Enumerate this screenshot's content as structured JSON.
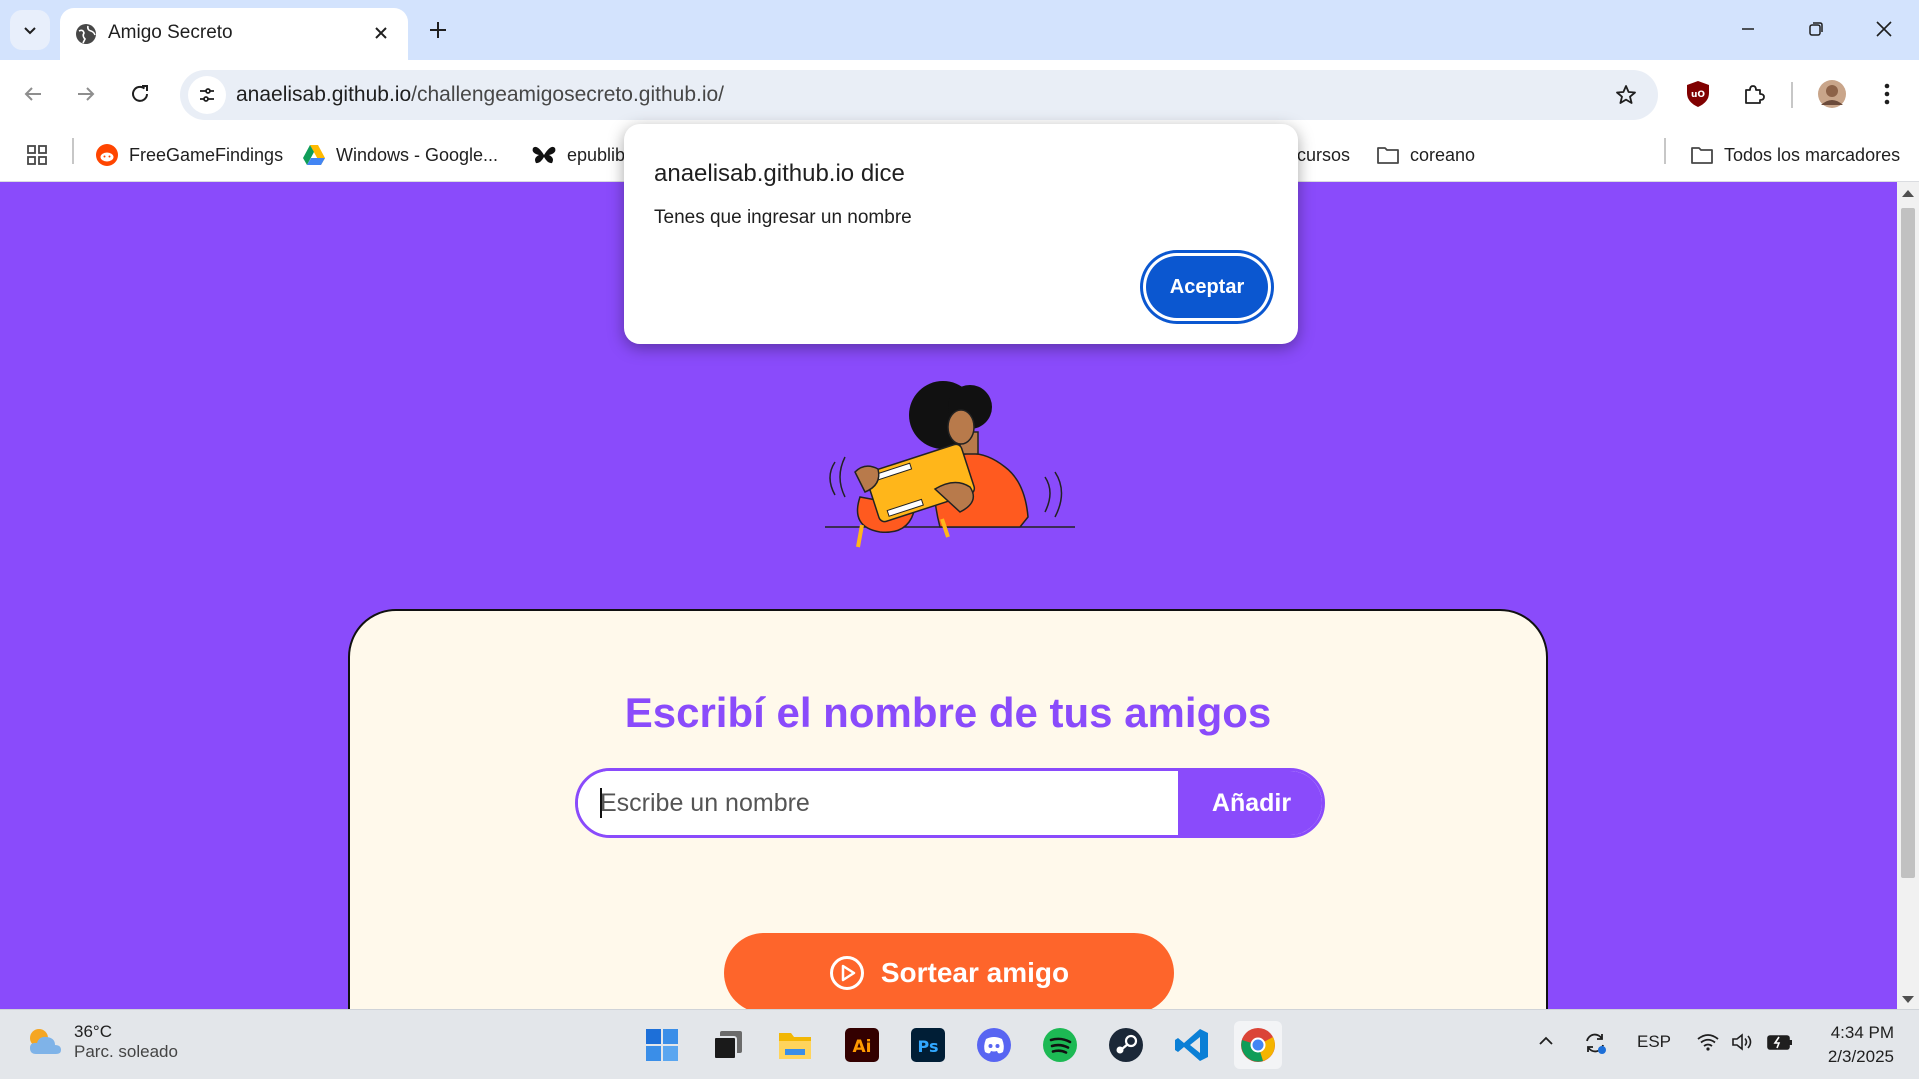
{
  "browser": {
    "tab": {
      "title": "Amigo Secreto"
    },
    "url": {
      "host": "anaelisab.github.io",
      "path": "/challengeamigosecreto.github.io/"
    },
    "bookmarks": [
      {
        "label": "FreeGameFindings"
      },
      {
        "label": "Windows - Google..."
      },
      {
        "label": "epublib"
      },
      {
        "label": "cursos"
      },
      {
        "label": "coreano"
      }
    ],
    "all_bookmarks": "Todos los marcadores"
  },
  "dialog": {
    "title": "anaelisab.github.io dice",
    "message": "Tenes que ingresar un nombre",
    "ok_label": "Aceptar"
  },
  "page": {
    "heading": "Escribí el nombre de tus amigos",
    "input_placeholder": "Escribe un nombre",
    "input_value": "",
    "add_label": "Añadir",
    "draw_label": "Sortear amigo",
    "colors": {
      "primary": "#8a4bfb",
      "accent": "#fe652b",
      "card_bg": "#fff9eb"
    }
  },
  "taskbar": {
    "weather": {
      "temp": "36°C",
      "condition": "Parc. soleado"
    },
    "apps": [
      "start-icon",
      "task-view-icon",
      "file-explorer-icon",
      "illustrator-icon",
      "photoshop-icon",
      "discord-icon",
      "spotify-icon",
      "steam-icon",
      "vscode-icon",
      "chrome-icon"
    ],
    "language": "ESP",
    "time": "4:34 PM",
    "date": "2/3/2025"
  }
}
